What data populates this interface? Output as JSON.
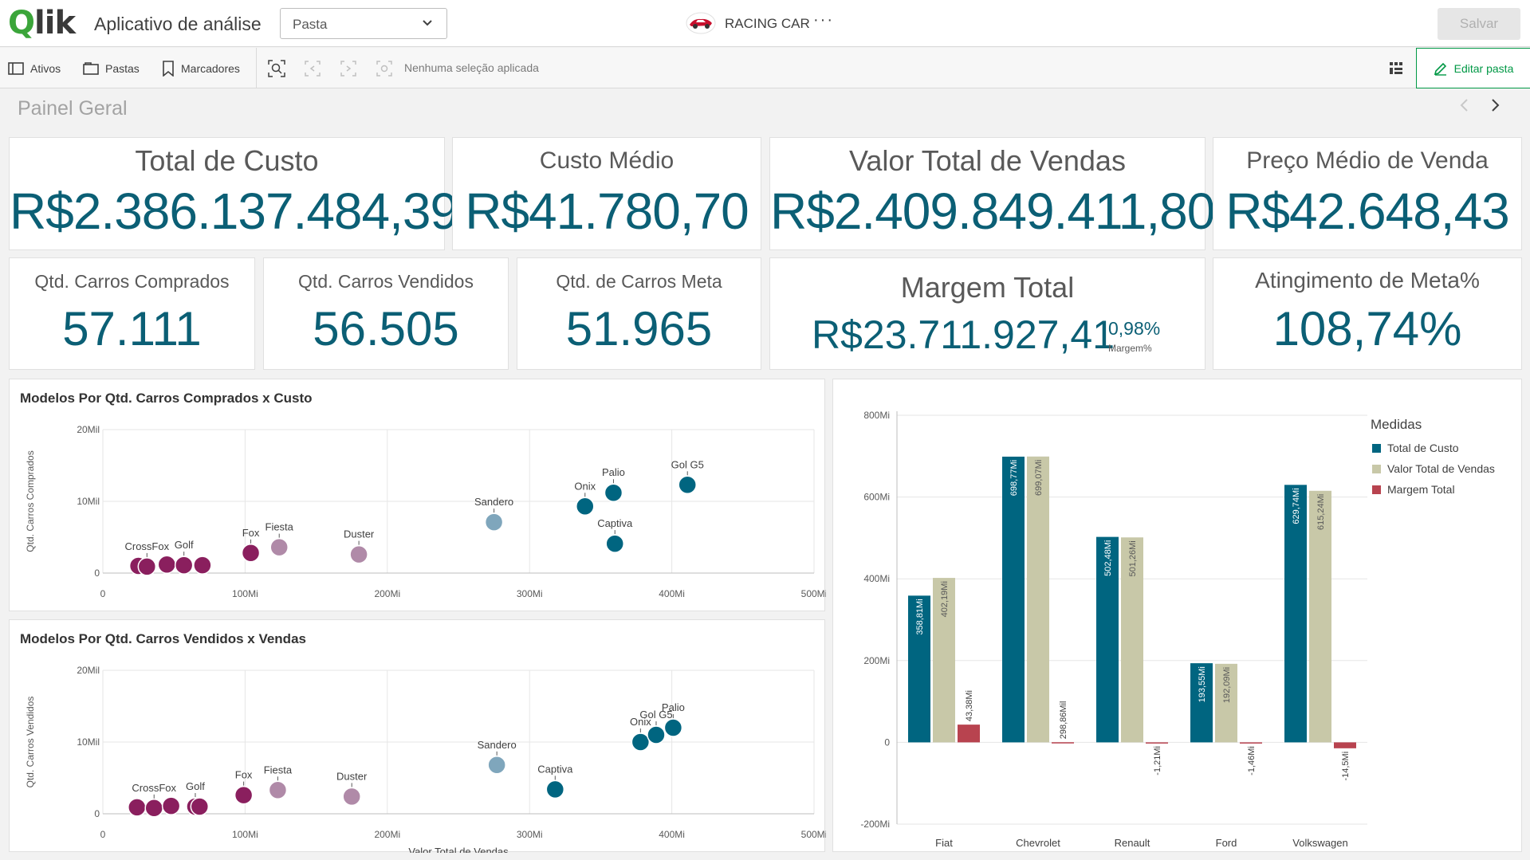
{
  "topbar": {
    "logo": "Qlik",
    "app_title": "Aplicativo de análise",
    "sheet_select_value": "Pasta",
    "brand_name": "RACING CAR",
    "more": "···",
    "save_label": "Salvar"
  },
  "toolbar": {
    "assets_label": "Ativos",
    "sheets_label": "Pastas",
    "bookmarks_label": "Marcadores",
    "no_selection": "Nenhuma seleção aplicada",
    "edit_label": "Editar pasta"
  },
  "sheet": {
    "title": "Painel Geral"
  },
  "kpis": {
    "total_custo": {
      "title": "Total de Custo",
      "value": "R$2.386.137.484,39"
    },
    "custo_medio": {
      "title": "Custo Médio",
      "value": "R$41.780,70"
    },
    "valor_total_vendas": {
      "title": "Valor Total de Vendas",
      "value": "R$2.409.849.411,80"
    },
    "preco_medio_venda": {
      "title": "Preço Médio de Venda",
      "value": "R$42.648,43"
    },
    "qtd_comprados": {
      "title": "Qtd. Carros Comprados",
      "value": "57.111"
    },
    "qtd_vendidos": {
      "title": "Qtd. Carros Vendidos",
      "value": "56.505"
    },
    "qtd_meta": {
      "title": "Qtd. de Carros Meta",
      "value": "51.965"
    },
    "margem_total": {
      "title": "Margem Total",
      "value": "R$23.711.927,41",
      "sub_value": "0,98%",
      "sub_label": "Margem%"
    },
    "atingimento": {
      "title": "Atingimento de Meta%",
      "value": "108,74%"
    }
  },
  "colors": {
    "accent": "#0b5f75",
    "dark_teal": "#006580",
    "khaki": "#c8c8a8",
    "red": "#b8434f",
    "purple_dark": "#8a1f5e",
    "purple_light": "#b08aa8",
    "blue_light": "#7fa6bc",
    "green": "#009845"
  },
  "chart_data": [
    {
      "type": "scatter",
      "title": "Modelos Por Qtd. Carros Comprados x Custo",
      "xlabel": "",
      "ylabel": "Qtd. Carros Comprados",
      "xlim": [
        0,
        500
      ],
      "ylim": [
        0,
        20
      ],
      "x_ticks": [
        "0",
        "100Mi",
        "200Mi",
        "300Mi",
        "400Mi",
        "500Mi"
      ],
      "y_ticks": [
        "0",
        "10Mil",
        "20Mil"
      ],
      "points": [
        {
          "label": "",
          "x": 25,
          "y": 1.0,
          "color": "purple_dark"
        },
        {
          "label": "CrossFox",
          "x": 31,
          "y": 0.9,
          "color": "purple_dark"
        },
        {
          "label": "",
          "x": 45,
          "y": 1.2,
          "color": "purple_dark"
        },
        {
          "label": "Golf",
          "x": 57,
          "y": 1.1,
          "color": "purple_dark"
        },
        {
          "label": "",
          "x": 70,
          "y": 1.1,
          "color": "purple_dark"
        },
        {
          "label": "Fox",
          "x": 104,
          "y": 2.8,
          "color": "purple_dark"
        },
        {
          "label": "Fiesta",
          "x": 124,
          "y": 3.6,
          "color": "purple_light"
        },
        {
          "label": "Duster",
          "x": 180,
          "y": 2.6,
          "color": "purple_light"
        },
        {
          "label": "Sandero",
          "x": 275,
          "y": 7.1,
          "color": "blue_light"
        },
        {
          "label": "Onix",
          "x": 339,
          "y": 9.3,
          "color": "dark_teal"
        },
        {
          "label": "Palio",
          "x": 359,
          "y": 11.2,
          "color": "dark_teal"
        },
        {
          "label": "Captiva",
          "x": 360,
          "y": 4.1,
          "color": "dark_teal"
        },
        {
          "label": "Gol G5",
          "x": 411,
          "y": 12.3,
          "color": "dark_teal"
        }
      ]
    },
    {
      "type": "scatter",
      "title": "Modelos Por Qtd. Carros Vendidos x Vendas",
      "xlabel": "Valor Total de Vendas",
      "ylabel": "Qtd. Carros Vendidos",
      "xlim": [
        0,
        500
      ],
      "ylim": [
        0,
        20
      ],
      "x_ticks": [
        "0",
        "100Mi",
        "200Mi",
        "300Mi",
        "400Mi",
        "500Mi"
      ],
      "y_ticks": [
        "0",
        "10Mil",
        "20Mil"
      ],
      "points": [
        {
          "label": "",
          "x": 24,
          "y": 0.9,
          "color": "purple_dark"
        },
        {
          "label": "CrossFox",
          "x": 36,
          "y": 0.8,
          "color": "purple_dark"
        },
        {
          "label": "",
          "x": 48,
          "y": 1.1,
          "color": "purple_dark"
        },
        {
          "label": "Golf",
          "x": 65,
          "y": 1.0,
          "color": "purple_dark"
        },
        {
          "label": "",
          "x": 68,
          "y": 1.0,
          "color": "purple_dark"
        },
        {
          "label": "Fox",
          "x": 99,
          "y": 2.6,
          "color": "purple_dark"
        },
        {
          "label": "Fiesta",
          "x": 123,
          "y": 3.3,
          "color": "purple_light"
        },
        {
          "label": "Duster",
          "x": 175,
          "y": 2.4,
          "color": "purple_light"
        },
        {
          "label": "Sandero",
          "x": 277,
          "y": 6.8,
          "color": "blue_light"
        },
        {
          "label": "Captiva",
          "x": 318,
          "y": 3.4,
          "color": "dark_teal"
        },
        {
          "label": "Onix",
          "x": 378,
          "y": 10.0,
          "color": "dark_teal"
        },
        {
          "label": "Gol G5",
          "x": 389,
          "y": 11.0,
          "color": "dark_teal"
        },
        {
          "label": "Palio",
          "x": 401,
          "y": 12.0,
          "color": "dark_teal"
        }
      ]
    },
    {
      "type": "bar",
      "title": "",
      "categories": [
        "Fiat",
        "Chevrolet",
        "Renault",
        "Ford",
        "Volkswagen"
      ],
      "ylim": [
        -200,
        800
      ],
      "y_ticks": [
        "-200Mi",
        "0",
        "200Mi",
        "400Mi",
        "600Mi",
        "800Mi"
      ],
      "legend_title": "Medidas",
      "legend_position": "right",
      "series": [
        {
          "name": "Total de Custo",
          "color": "dark_teal",
          "values": [
            358.81,
            698.77,
            502.48,
            193.55,
            629.74
          ],
          "labels": [
            "358,81Mi",
            "698,77Mi",
            "502,48Mi",
            "193,55Mi",
            "629,74Mi"
          ]
        },
        {
          "name": "Valor Total de Vendas",
          "color": "khaki",
          "values": [
            402.19,
            699.07,
            501.26,
            192.09,
            615.24
          ],
          "labels": [
            "402,19Mi",
            "699,07Mi",
            "501,26Mi",
            "192,09Mi",
            "615,24Mi"
          ]
        },
        {
          "name": "Margem Total",
          "color": "red",
          "values": [
            43.38,
            0.299,
            -1.21,
            -1.46,
            -14.5
          ],
          "labels": [
            "43,38Mi",
            "298,86Mil",
            "-1,21Mi",
            "-1,46Mi",
            "-14,5Mi"
          ]
        }
      ]
    }
  ]
}
